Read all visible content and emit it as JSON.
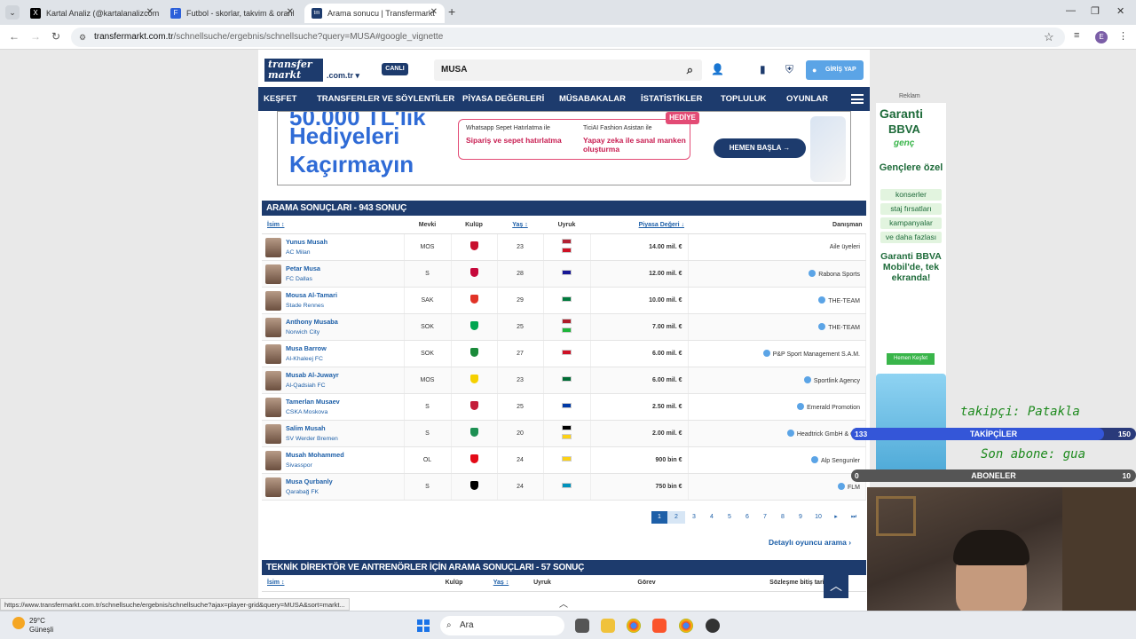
{
  "browser": {
    "tabs": [
      {
        "title": "Kartal Analiz (@kartalanalizcom",
        "favicon": "X"
      },
      {
        "title": "Futbol - skorlar, takvim & oranl",
        "favicon": "F"
      },
      {
        "title": "Arama sonucu | Transfermarkt",
        "favicon": "tm"
      }
    ],
    "url_host": "transfermarkt.com.tr",
    "url_path": "/schnellsuche/ergebnis/schnellsuche?query=MUSA#google_vignette",
    "profile_initial": "E"
  },
  "site": {
    "logo_line1": "transfer",
    "logo_line2": "markt",
    "logo_tld": ".com.tr",
    "live_badge": "CANLI",
    "search_value": "MUSA",
    "login_label": "GİRİŞ YAP",
    "nav": [
      "KEŞFET",
      "TRANSFERLER VE SÖYLENTİLER",
      "PİYASA DEĞERLERİ",
      "MÜSABAKALAR",
      "İSTATİSTİKLER",
      "TOPLULUK",
      "OYUNLAR"
    ]
  },
  "banner": {
    "top_partial": "50.000 TL'lik",
    "line1": "Hediyeleri",
    "line2": "Kaçırmayın",
    "col1_small": "Whatsapp Sepet Hatırlatma ile",
    "col1_bold": "Sipariş ve sepet hatırlatma",
    "col2_small": "TiciAI Fashion Asistan ile",
    "col2_bold": "Yapay zeka ile sanal manken oluşturma",
    "tag": "HEDİYE",
    "cta": "HEMEN BAŞLA →"
  },
  "results": {
    "title": "ARAMA SONUÇLARI - 943 SONUÇ",
    "headers": {
      "name": "İsim ↕",
      "position": "Mevki",
      "club": "Kulüp",
      "age": "Yaş ↕",
      "nationality": "Uyruk",
      "value": "Piyasa Değeri ↓",
      "agent": "Danışman"
    },
    "rows": [
      {
        "name": "Yunus Musah",
        "club": "AC Milan",
        "pos": "MOS",
        "age": "23",
        "value": "14.00 mil. €",
        "agent": "Aile üyeleri",
        "verified": false,
        "crest": "#c8102e",
        "flags": [
          "#b22234",
          "#ce1124"
        ]
      },
      {
        "name": "Petar Musa",
        "club": "FC Dallas",
        "pos": "S",
        "age": "28",
        "value": "12.00 mil. €",
        "agent": "Rabona Sports",
        "verified": true,
        "crest": "#c6093b",
        "flags": [
          "#171796"
        ]
      },
      {
        "name": "Mousa Al-Tamari",
        "club": "Stade Rennes",
        "pos": "SAK",
        "age": "29",
        "value": "10.00 mil. €",
        "agent": "THE-TEAM",
        "verified": true,
        "crest": "#e13327",
        "flags": [
          "#007a3d"
        ]
      },
      {
        "name": "Anthony Musaba",
        "club": "Norwich City",
        "pos": "SOK",
        "age": "25",
        "value": "7.00 mil. €",
        "agent": "THE-TEAM",
        "verified": true,
        "crest": "#00a650",
        "flags": [
          "#ae1c28",
          "#1eb53a"
        ]
      },
      {
        "name": "Musa Barrow",
        "club": "Al-Khaleej FC",
        "pos": "SOK",
        "age": "27",
        "value": "6.00 mil. €",
        "agent": "P&P Sport Management S.A.M.",
        "verified": true,
        "crest": "#1a8a3a",
        "flags": [
          "#ce1126"
        ]
      },
      {
        "name": "Musab Al-Juwayr",
        "club": "Al-Qadsiah FC",
        "pos": "MOS",
        "age": "23",
        "value": "6.00 mil. €",
        "agent": "Sportlink Agency",
        "verified": true,
        "crest": "#f5d000",
        "flags": [
          "#006c35"
        ]
      },
      {
        "name": "Tamerlan Musaev",
        "club": "CSKA Moskova",
        "pos": "S",
        "age": "25",
        "value": "2.50 mil. €",
        "agent": "Emerald Promotion",
        "verified": true,
        "crest": "#c41e3a",
        "flags": [
          "#0039a6"
        ]
      },
      {
        "name": "Salim Musah",
        "club": "SV Werder Bremen",
        "pos": "S",
        "age": "20",
        "value": "2.00 mil. €",
        "agent": "Headtrick GmbH & Co.",
        "verified": true,
        "crest": "#1d9053",
        "flags": [
          "#000000",
          "#fcd116"
        ]
      },
      {
        "name": "Musah Mohammed",
        "club": "Sivasspor",
        "pos": "OL",
        "age": "24",
        "value": "900 bin €",
        "agent": "Alp Sengunler",
        "verified": true,
        "crest": "#e30a17",
        "flags": [
          "#fcd116"
        ]
      },
      {
        "name": "Musa Qurbanly",
        "club": "Qarabağ FK",
        "pos": "S",
        "age": "24",
        "value": "750 bin €",
        "agent": "FLM",
        "verified": true,
        "crest": "#000000",
        "flags": [
          "#0092bc"
        ]
      }
    ],
    "pages": [
      "1",
      "2",
      "3",
      "4",
      "5",
      "6",
      "7",
      "8",
      "9",
      "10",
      "▸",
      "⏭"
    ],
    "current_page": "1",
    "detail_link": "Detaylı oyuncu arama"
  },
  "coaches": {
    "title": "TEKNİK DİREKTÖR VE ANTRENÖRLER İÇİN ARAMA SONUÇLARI - 57 SONUÇ",
    "headers": {
      "name": "İsim ↕",
      "club": "Kulüp",
      "age": "Yaş ↕",
      "nationality": "Uyruk",
      "role": "Görev",
      "contract": "Sözleşme bitiş tarihi"
    }
  },
  "status_url": "https://www.transfermarkt.com.tr/schnellsuche/ergebnis/schnellsuche?ajax=player-grid&query=MUSA&sort=markt...",
  "ad": {
    "label": "Reklam",
    "brand1": "Garanti",
    "brand2": "BBVA",
    "brand3": "genç",
    "headline": "Gençlere özel",
    "pills": [
      "konserler",
      "staj fırsatları",
      "kampanyalar",
      "ve daha fazlası"
    ],
    "sub": "Garanti BBVA Mobil'de, tek ekranda!",
    "button": "Hemen Keşfet"
  },
  "overlay": {
    "follower_ticker": "takipçi: Patakla",
    "followers_label": "TAKİPÇİLER",
    "followers_current": "133",
    "followers_goal": "150",
    "subscriber_ticker": "Son abone: gua",
    "subscribers_label": "ABONELER",
    "subscribers_current": "0",
    "subscribers_goal": "10"
  },
  "taskbar": {
    "temperature": "29°C",
    "weather": "Güneşli",
    "search_placeholder": "Ara"
  }
}
